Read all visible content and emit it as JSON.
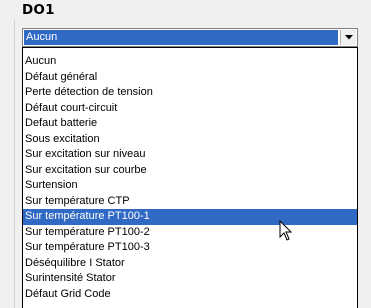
{
  "section": {
    "title": "DO1"
  },
  "combo": {
    "value": "Aucun",
    "arrow_icon": "chevron-down-icon"
  },
  "dropdown": {
    "options": [
      "Aucun",
      "Défaut général",
      "Perte détection de tension",
      "Défaut court-circuit",
      "Defaut batterie",
      "Sous excitation",
      "Sur excitation sur niveau",
      "Sur excitation sur courbe",
      "Surtension",
      "Sur température CTP",
      "Sur température PT100-1",
      "Sur température PT100-2",
      "Sur température PT100-3",
      "Déséquilibre I Stator",
      "Surintensité Stator",
      "Défaut Grid Code"
    ],
    "selected_index": 10
  },
  "colors": {
    "selection": "#316ac5",
    "background": "#f0f0f0",
    "list_background": "#ffffff"
  },
  "cursor_icon": "arrow-pointer-icon"
}
